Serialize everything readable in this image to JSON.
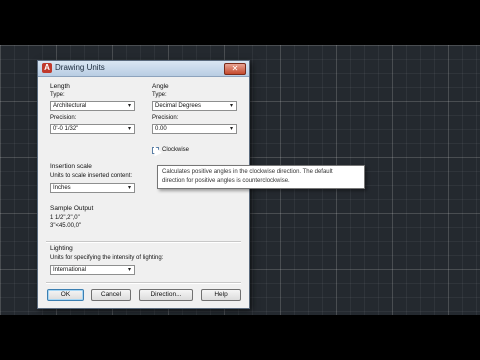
{
  "dialog": {
    "title": "Drawing Units",
    "app_icon_glyph": "A",
    "close_glyph": "✕"
  },
  "length": {
    "group_label": "Length",
    "type_label": "Type:",
    "type_value": "Architectural",
    "precision_label": "Precision:",
    "precision_value": "0'-0 1/32\""
  },
  "angle": {
    "group_label": "Angle",
    "type_label": "Type:",
    "type_value": "Decimal Degrees",
    "precision_label": "Precision:",
    "precision_value": "0.00",
    "clockwise_label": "Clockwise",
    "clockwise_checked": false
  },
  "insertion": {
    "group_label": "Insertion scale",
    "units_label": "Units to scale inserted content:",
    "units_value": "Inches"
  },
  "sample": {
    "group_label": "Sample Output",
    "line1": "1 1/2\",2\",0\"",
    "line2": "3\"<45.00,0\""
  },
  "lighting": {
    "group_label": "Lighting",
    "units_label": "Units for specifying the intensity of lighting:",
    "units_value": "International"
  },
  "buttons": {
    "ok": "OK",
    "cancel": "Cancel",
    "direction": "Direction...",
    "help": "Help"
  },
  "tooltip": {
    "line1": "Calculates positive angles in the clockwise direction. The default",
    "line2": "direction for positive angles is counterclockwise."
  },
  "icons": {
    "dropdown_arrow": "▾"
  }
}
